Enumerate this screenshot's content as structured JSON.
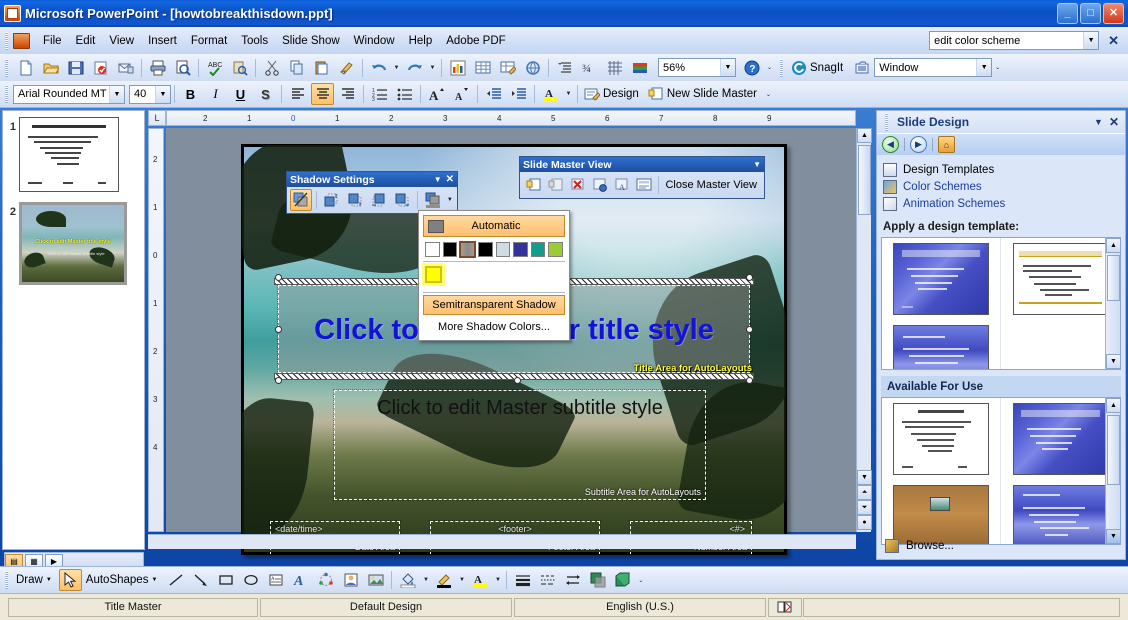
{
  "window": {
    "title": "Microsoft PowerPoint - [howtobreakthisdown.ppt]",
    "app_icon": "powerpoint-icon",
    "minimize": "_",
    "maximize": "□",
    "close": "✕"
  },
  "menubar": {
    "items": [
      {
        "label": "File"
      },
      {
        "label": "Edit"
      },
      {
        "label": "View"
      },
      {
        "label": "Insert"
      },
      {
        "label": "Format"
      },
      {
        "label": "Tools"
      },
      {
        "label": "Slide Show"
      },
      {
        "label": "Window"
      },
      {
        "label": "Help"
      },
      {
        "label": "Adobe PDF"
      }
    ],
    "ask_box_value": "edit color scheme",
    "close_label": "✕"
  },
  "standard_toolbar": {
    "buttons": [
      {
        "name": "new-icon"
      },
      {
        "name": "open-icon"
      },
      {
        "name": "save-icon"
      },
      {
        "name": "mail-icon"
      },
      {
        "name": "permission-icon"
      },
      {
        "name": "print-icon"
      },
      {
        "name": "print-preview-icon"
      },
      {
        "name": "spelling-icon"
      },
      {
        "name": "research-icon"
      },
      {
        "name": "cut-icon"
      },
      {
        "name": "copy-icon"
      },
      {
        "name": "paste-icon"
      },
      {
        "name": "format-painter-icon"
      },
      {
        "name": "undo-icon"
      },
      {
        "name": "redo-icon"
      },
      {
        "name": "chart-icon"
      },
      {
        "name": "table-icon"
      },
      {
        "name": "drawing-table-icon"
      },
      {
        "name": "hyperlink-icon"
      },
      {
        "name": "expand-all-icon"
      },
      {
        "name": "show-formatting-icon"
      },
      {
        "name": "grid-icon"
      },
      {
        "name": "color-grayscale-icon"
      }
    ],
    "zoom_value": "56%",
    "help_icon": "help-icon",
    "snagit_label": "SnagIt",
    "snagit_window_value": "Window"
  },
  "formatting_toolbar": {
    "font_name": "Arial Rounded MT Bol",
    "font_size": "40",
    "bold": "B",
    "italic": "I",
    "underline": "U",
    "shadow": "S",
    "align_left": "align-left-icon",
    "align_center": "align-center-icon",
    "align_right": "align-right-icon",
    "numbering": "numbering-icon",
    "bullets": "bullets-icon",
    "increase_font": "A",
    "decrease_font": "A",
    "decrease_indent": "decrease-indent-icon",
    "increase_indent": "increase-indent-icon",
    "font_color": "A",
    "design_label": "Design",
    "new_slide_master_label": "New Slide Master"
  },
  "slide_thumbnails": [
    {
      "number": "1",
      "selected": false,
      "type": "outline-master"
    },
    {
      "number": "2",
      "selected": true,
      "type": "title-master",
      "title_text": "Click to edit Master title style",
      "subtitle_text": "Click to edit Master subtitle style"
    }
  ],
  "ruler": {
    "horizontal_ticks": [
      "2",
      "1",
      "0",
      "1",
      "2",
      "3",
      "4",
      "5",
      "6",
      "7",
      "8",
      "9"
    ],
    "vertical_ticks": [
      "2",
      "1",
      "0",
      "1",
      "2",
      "3",
      "4"
    ],
    "corner_glyph": "L"
  },
  "slide": {
    "title_placeholder": {
      "text": "Click to edit Master title style",
      "label": "Title Area for AutoLayouts",
      "color": "#1212dd",
      "selected": true
    },
    "subtitle_placeholder": {
      "text": "Click to edit Master subtitle style",
      "label": "Subtitle Area for AutoLayouts",
      "color": "#111111"
    },
    "footers": [
      {
        "code": "<date/time>",
        "label": "Date Area",
        "name": "date-placeholder"
      },
      {
        "code": "<footer>",
        "label": "Footer Area",
        "name": "footer-placeholder"
      },
      {
        "code": "<#>",
        "label": "Number Area",
        "name": "number-placeholder"
      }
    ]
  },
  "shadow_settings": {
    "title": "Shadow Settings",
    "dropdown_glyph": "▼",
    "close_glyph": "✕",
    "buttons": [
      {
        "name": "shadow-on-off-button",
        "selected": true
      },
      {
        "name": "nudge-shadow-up-button",
        "selected": false
      },
      {
        "name": "nudge-shadow-down-button",
        "selected": false
      },
      {
        "name": "nudge-shadow-left-button",
        "selected": false
      },
      {
        "name": "nudge-shadow-right-button",
        "selected": false
      },
      {
        "name": "shadow-color-button",
        "selected": false
      }
    ]
  },
  "shadow_color_menu": {
    "automatic_label": "Automatic",
    "automatic_swatch": "#808080",
    "colors": [
      {
        "hex": "#ffffff",
        "name": "white",
        "selected": false
      },
      {
        "hex": "#000000",
        "name": "black",
        "selected": false
      },
      {
        "hex": "#9a8d7a",
        "name": "tan-gray",
        "selected": true
      },
      {
        "hex": "#000000",
        "name": "black-2",
        "selected": false
      },
      {
        "hex": "#cfdce4",
        "name": "pale-blue",
        "selected": false
      },
      {
        "hex": "#333399",
        "name": "indigo",
        "selected": false
      },
      {
        "hex": "#139c8c",
        "name": "teal",
        "selected": false
      },
      {
        "hex": "#9acd32",
        "name": "yellow-green",
        "selected": false
      }
    ],
    "recent_color": {
      "hex": "#ffff00",
      "name": "yellow",
      "hovered": true
    },
    "semitransparent_label": "Semitransparent Shadow",
    "more_colors_label": "More Shadow Colors..."
  },
  "slide_master_view": {
    "title": "Slide Master View",
    "dropdown_glyph": "▼",
    "buttons": [
      {
        "name": "insert-new-slide-master-button"
      },
      {
        "name": "insert-new-title-master-button"
      },
      {
        "name": "delete-master-button"
      },
      {
        "name": "preserve-master-button"
      },
      {
        "name": "rename-master-button"
      },
      {
        "name": "master-layout-button"
      }
    ],
    "close_label": "Close Master View"
  },
  "task_pane": {
    "title": "Slide Design",
    "dropdown_glyph": "▼",
    "close_glyph": "✕",
    "nav": {
      "back": "◀",
      "forward": "▶",
      "home": "⌂"
    },
    "links": [
      {
        "label": "Design Templates",
        "icon": "design-templates-icon",
        "active": true
      },
      {
        "label": "Color Schemes",
        "icon": "color-schemes-icon",
        "active": false
      },
      {
        "label": "Animation Schemes",
        "icon": "animation-schemes-icon",
        "active": false
      }
    ],
    "apply_heading": "Apply a design template:",
    "available_heading": "Available For Use",
    "browse_label": "Browse...",
    "applied_templates": [
      {
        "name": "template-blue-waves",
        "style": "blue"
      },
      {
        "name": "template-white-gold-bar",
        "style": "white"
      },
      {
        "name": "template-blue-clouds",
        "style": "blue2"
      },
      {
        "name": "template-empty",
        "style": "empty"
      }
    ],
    "available_templates": [
      {
        "name": "template-default-white",
        "style": "white"
      },
      {
        "name": "template-blue-ripple",
        "style": "blue"
      },
      {
        "name": "template-brown-gradient",
        "style": "brown"
      },
      {
        "name": "template-blue-sky",
        "style": "blue2"
      },
      {
        "name": "template-dark-navy-1",
        "style": "dark"
      },
      {
        "name": "template-dark-navy-2",
        "style": "dark"
      }
    ]
  },
  "view_buttons": [
    {
      "name": "normal-view-button",
      "selected": true,
      "glyph": "▤"
    },
    {
      "name": "slide-sorter-view-button",
      "selected": false,
      "glyph": "▦"
    },
    {
      "name": "slide-show-button",
      "selected": false,
      "glyph": "▶"
    }
  ],
  "drawing_toolbar": {
    "draw_label": "Draw",
    "select_tool": "select-arrow-icon",
    "autoshapes_label": "AutoShapes",
    "buttons": [
      {
        "name": "line-icon"
      },
      {
        "name": "arrow-icon"
      },
      {
        "name": "rectangle-icon"
      },
      {
        "name": "oval-icon"
      },
      {
        "name": "text-box-icon"
      },
      {
        "name": "wordart-icon"
      },
      {
        "name": "diagram-icon"
      },
      {
        "name": "clip-art-icon"
      },
      {
        "name": "picture-icon"
      },
      {
        "name": "fill-color-icon"
      },
      {
        "name": "line-color-icon"
      },
      {
        "name": "font-color-icon"
      },
      {
        "name": "line-style-icon"
      },
      {
        "name": "dash-style-icon"
      },
      {
        "name": "arrow-style-icon"
      },
      {
        "name": "shadow-style-icon"
      },
      {
        "name": "3d-style-icon"
      }
    ]
  },
  "status_bar": {
    "cells": [
      {
        "label": "Title Master",
        "name": "status-master-type"
      },
      {
        "label": "Default Design",
        "name": "status-design-name"
      },
      {
        "label": "English (U.S.)",
        "name": "status-language"
      }
    ],
    "spell_icon": "spell-check-icon"
  },
  "colors": {
    "title_blue": "#1212dd",
    "placeholder_yellow": "#ffff33",
    "accent_orange": "#ffbf70",
    "titlebar_blue": "#0a4fc4",
    "taskpane_bg": "#dbe6f8"
  }
}
